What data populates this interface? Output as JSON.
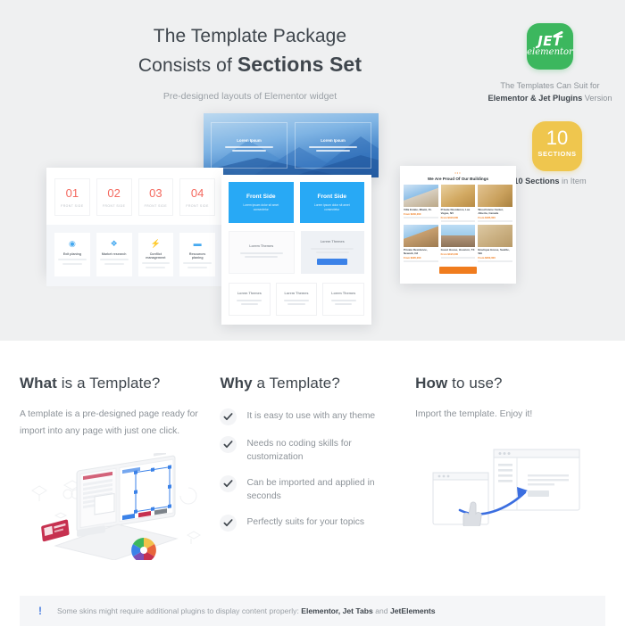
{
  "hero": {
    "title_line1": "The Template Package",
    "title_line2_prefix": "Consists of ",
    "title_line2_bold": "Sections Set",
    "subtitle": "Pre-designed layouts of Elementor widget",
    "bg_color": "#eff0f1"
  },
  "brand": {
    "logo_main": "JET",
    "logo_sub": "elementor",
    "logo_color": "#3cb75e",
    "line1": "The Templates Can Suit for",
    "line2_bold": "Elementor & Jet Plugins",
    "line2_rest": " Version"
  },
  "sections_badge": {
    "number": "10",
    "label": "SECTIONS",
    "color": "#efc64e",
    "note_bold": "10 Sections",
    "note_rest": " in Item"
  },
  "mockups": {
    "banner": {
      "columns": [
        {
          "title": "Lorem Ipsum"
        },
        {
          "title": "Lorem Ipsum"
        }
      ]
    },
    "left_card": {
      "numbers": [
        {
          "n": "01",
          "caption": "FRONT SIDE"
        },
        {
          "n": "02",
          "caption": "FRONT SIDE"
        },
        {
          "n": "03",
          "caption": "FRONT SIDE"
        },
        {
          "n": "04",
          "caption": "FRONT SIDE"
        }
      ],
      "number_color": "#f4695f",
      "features": [
        {
          "icon": "eye-icon",
          "glyph": "◉",
          "title": "Exit planing"
        },
        {
          "icon": "gift-icon",
          "glyph": "❖",
          "title": "Market research"
        },
        {
          "icon": "bolt-icon",
          "glyph": "⚡",
          "title": "Conflict management"
        },
        {
          "icon": "briefcase-icon",
          "glyph": "▬",
          "title": "Resources planing"
        }
      ]
    },
    "middle_card": {
      "front_cards": [
        {
          "title": "Front Side",
          "desc": "Lorem ipsum dolor sit amet consectetur"
        },
        {
          "title": "Front Side",
          "desc": "Lorem ipsum dolor sit amet consectetur"
        }
      ],
      "blocks": [
        {
          "title": "Lorem Themes"
        },
        {
          "title": "Lorem Themes"
        }
      ],
      "bottom_blocks": [
        {
          "title": "Lorem Themes"
        },
        {
          "title": "Lorem Themes"
        },
        {
          "title": "Lorem Themes"
        }
      ],
      "accent_color": "#28a9f5"
    },
    "right_card": {
      "eyebrow": "•••",
      "title": "We Are Proud Of Our Buildings",
      "items": [
        {
          "caption": "Villa Estate, Miami, FL",
          "price": "From $240,000"
        },
        {
          "caption": "Private Residence, Las Vegas, NV",
          "price": "From $310,000"
        },
        {
          "caption": "Wood Home Center, Alberta, Canada",
          "price": "From $185,000"
        },
        {
          "caption": "Private Residence, Newark, NJ",
          "price": "From $220,000"
        },
        {
          "caption": "Guest House, Houston, TX",
          "price": "From $195,000"
        },
        {
          "caption": "Boutique House, Seattle, WA",
          "price": "From $260,000"
        }
      ],
      "button_label": "View All Buildings",
      "button_color": "#f07c1e"
    }
  },
  "info": {
    "what": {
      "heading_bold": "What",
      "heading_rest": " is a Template?",
      "paragraph": "A template is a pre-designed page ready for import into any page with just one click."
    },
    "why": {
      "heading_bold": "Why",
      "heading_rest": " a Template?",
      "items": [
        "It is easy to use with any theme",
        "Needs no coding skills for customization",
        "Can be imported and applied in seconds",
        "Perfectly suits for your topics"
      ]
    },
    "how": {
      "heading_bold": "How",
      "heading_rest": " to use?",
      "paragraph": "Import the template. Enjoy it!"
    }
  },
  "notice": {
    "icon": "exclamation-icon",
    "text_before": "Some skins might require additional plugins to display content properly: ",
    "bold1": "Elementor, Jet Tabs",
    "middle": " and ",
    "bold2": "JetElements"
  }
}
